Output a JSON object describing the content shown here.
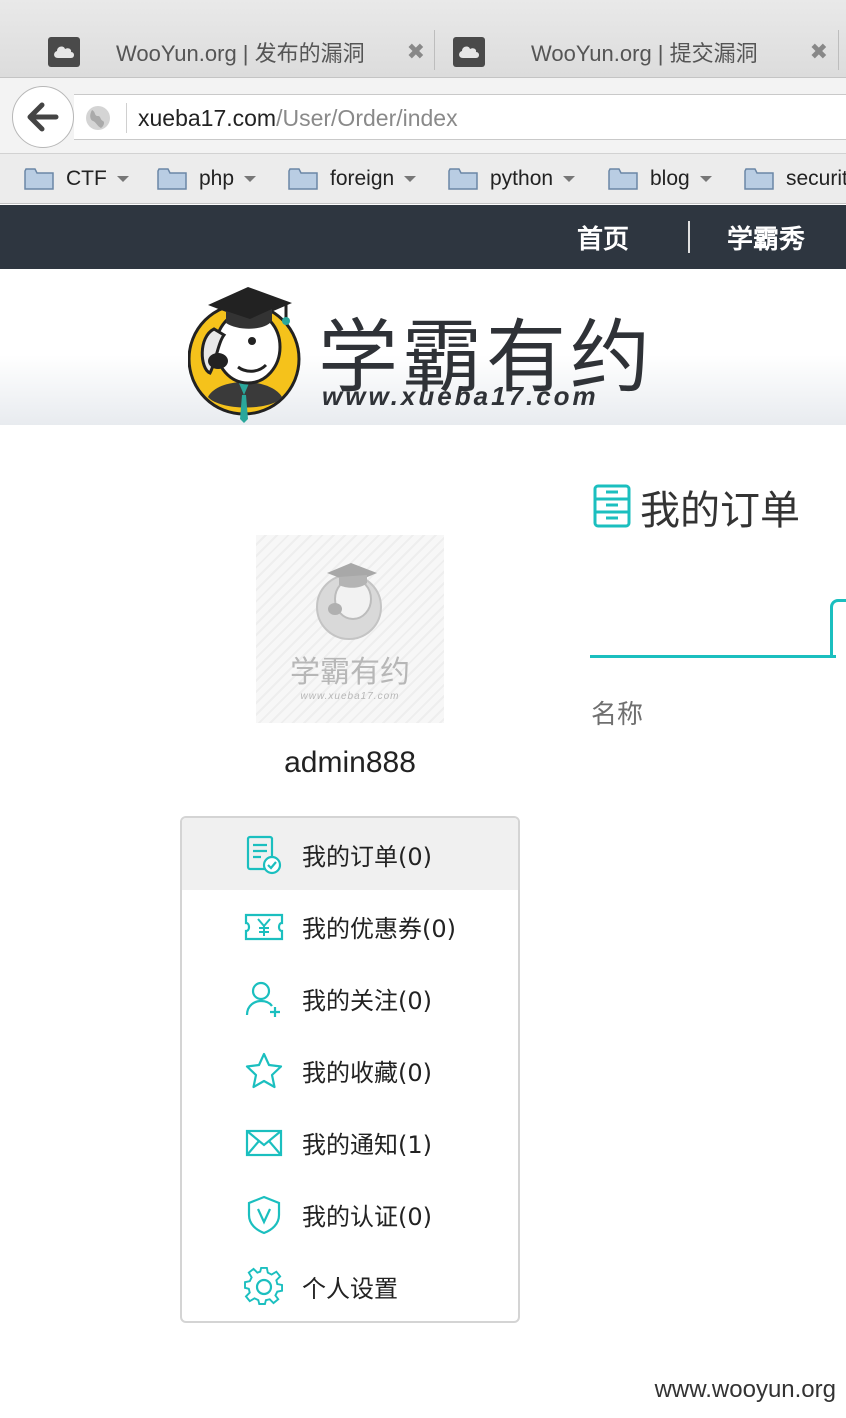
{
  "browser": {
    "tabs": [
      {
        "title": "WooYun.org | 发布的漏洞",
        "icon": "cloud-favicon-icon",
        "close": "✖"
      },
      {
        "title": "WooYun.org | 提交漏洞",
        "icon": "cloud-favicon-icon",
        "close": "✖"
      }
    ],
    "url": {
      "host": "xueba17.com",
      "path": "/User/Order/index"
    },
    "bookmarks": [
      {
        "label": "CTF"
      },
      {
        "label": "php"
      },
      {
        "label": "foreign"
      },
      {
        "label": "python"
      },
      {
        "label": "blog"
      },
      {
        "label": "securit"
      }
    ]
  },
  "site": {
    "nav": {
      "home": "首页",
      "showcase": "学霸秀"
    },
    "brand": {
      "name": "学霸有约",
      "url": "www.xueba17.com"
    },
    "avatar": {
      "brand": "学霸有约",
      "url": "www.xueba17.com"
    },
    "username": "admin888",
    "menu": [
      {
        "label": "我的订单(0)",
        "icon": "order-document-icon",
        "active": true
      },
      {
        "label": "我的优惠券(0)",
        "icon": "coupon-yen-icon",
        "active": false
      },
      {
        "label": "我的关注(0)",
        "icon": "user-add-icon",
        "active": false
      },
      {
        "label": "我的收藏(0)",
        "icon": "star-icon",
        "active": false
      },
      {
        "label": "我的通知(1)",
        "icon": "envelope-icon",
        "active": false
      },
      {
        "label": "我的认证(0)",
        "icon": "shield-v-icon",
        "active": false
      },
      {
        "label": "个人设置",
        "icon": "gear-icon",
        "active": false
      }
    ],
    "main": {
      "section_title": "我的订单",
      "section_icon": "cabinet-icon",
      "column_name": "名称"
    },
    "accent_color": "#1bbfbf",
    "nav_bg_color": "#2e3640"
  },
  "watermark": "www.wooyun.org"
}
